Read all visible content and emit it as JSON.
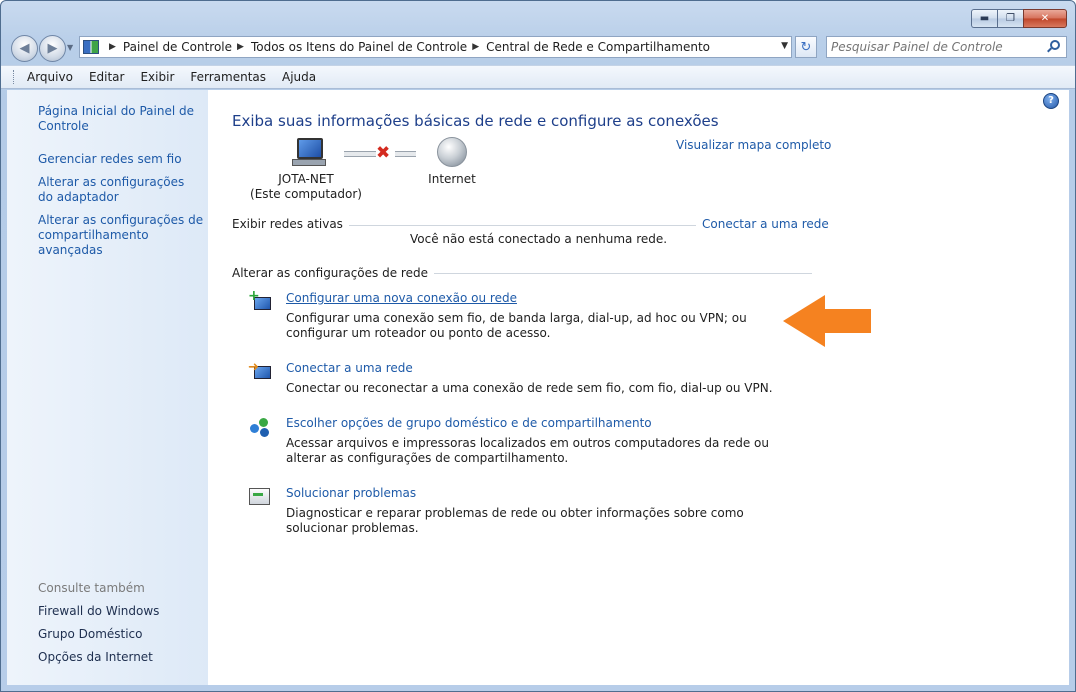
{
  "window": {
    "caption_buttons": {
      "minimize": "▬",
      "maximize": "❐",
      "close": "✕"
    }
  },
  "nav": {
    "back_glyph": "◀",
    "forward_glyph": "▶",
    "dropdown_glyph": "▼",
    "breadcrumbs": [
      "Painel de Controle",
      "Todos os Itens do Painel de Controle",
      "Central de Rede e Compartilhamento"
    ],
    "crumb_sep": "▶",
    "refresh_glyph": "↻",
    "search_placeholder": "Pesquisar Painel de Controle"
  },
  "menu": [
    "Arquivo",
    "Editar",
    "Exibir",
    "Ferramentas",
    "Ajuda"
  ],
  "sidebar": {
    "links": [
      {
        "label": "Página Inicial do Painel de Controle"
      },
      {
        "label": "Gerenciar redes sem fio"
      },
      {
        "label": "Alterar as configurações do adaptador"
      },
      {
        "label": "Alterar as configurações de compartilhamento avançadas"
      }
    ],
    "see_also_title": "Consulte também",
    "see_also": [
      "Firewall do Windows",
      "Grupo Doméstico",
      "Opções da Internet"
    ]
  },
  "main": {
    "help_glyph": "?",
    "heading": "Exiba suas informações básicas de rede e configure as conexões",
    "map_link": "Visualizar mapa completo",
    "computer_name": "JOTA-NET",
    "computer_sub": "(Este computador)",
    "disconnected_glyph": "✖",
    "internet_label": "Internet",
    "active_label": "Exibir redes ativas",
    "connect_link": "Conectar a uma rede",
    "no_network": "Você não está conectado a nenhuma rede.",
    "change_label": "Alterar as configurações de rede",
    "tasks": [
      {
        "title": "Configurar uma nova conexão ou rede",
        "desc": "Configurar uma conexão sem fio, de banda larga, dial-up, ad hoc ou VPN; ou configurar um roteador ou ponto de acesso.",
        "icon": "new-connection-icon"
      },
      {
        "title": "Conectar a uma rede",
        "desc": "Conectar ou reconectar a uma conexão de rede sem fio, com fio, dial-up ou VPN.",
        "icon": "connect-network-icon"
      },
      {
        "title": "Escolher opções de grupo doméstico e de compartilhamento",
        "desc": "Acessar arquivos e impressoras localizados em outros computadores da rede ou alterar as configurações de compartilhamento.",
        "icon": "homegroup-icon"
      },
      {
        "title": "Solucionar problemas",
        "desc": "Diagnosticar e reparar problemas de rede ou obter informações sobre como solucionar problemas.",
        "icon": "troubleshoot-icon"
      }
    ]
  },
  "colors": {
    "link": "#1e5aa8",
    "heading": "#1e3f8a",
    "annotation_arrow": "#f58220"
  }
}
